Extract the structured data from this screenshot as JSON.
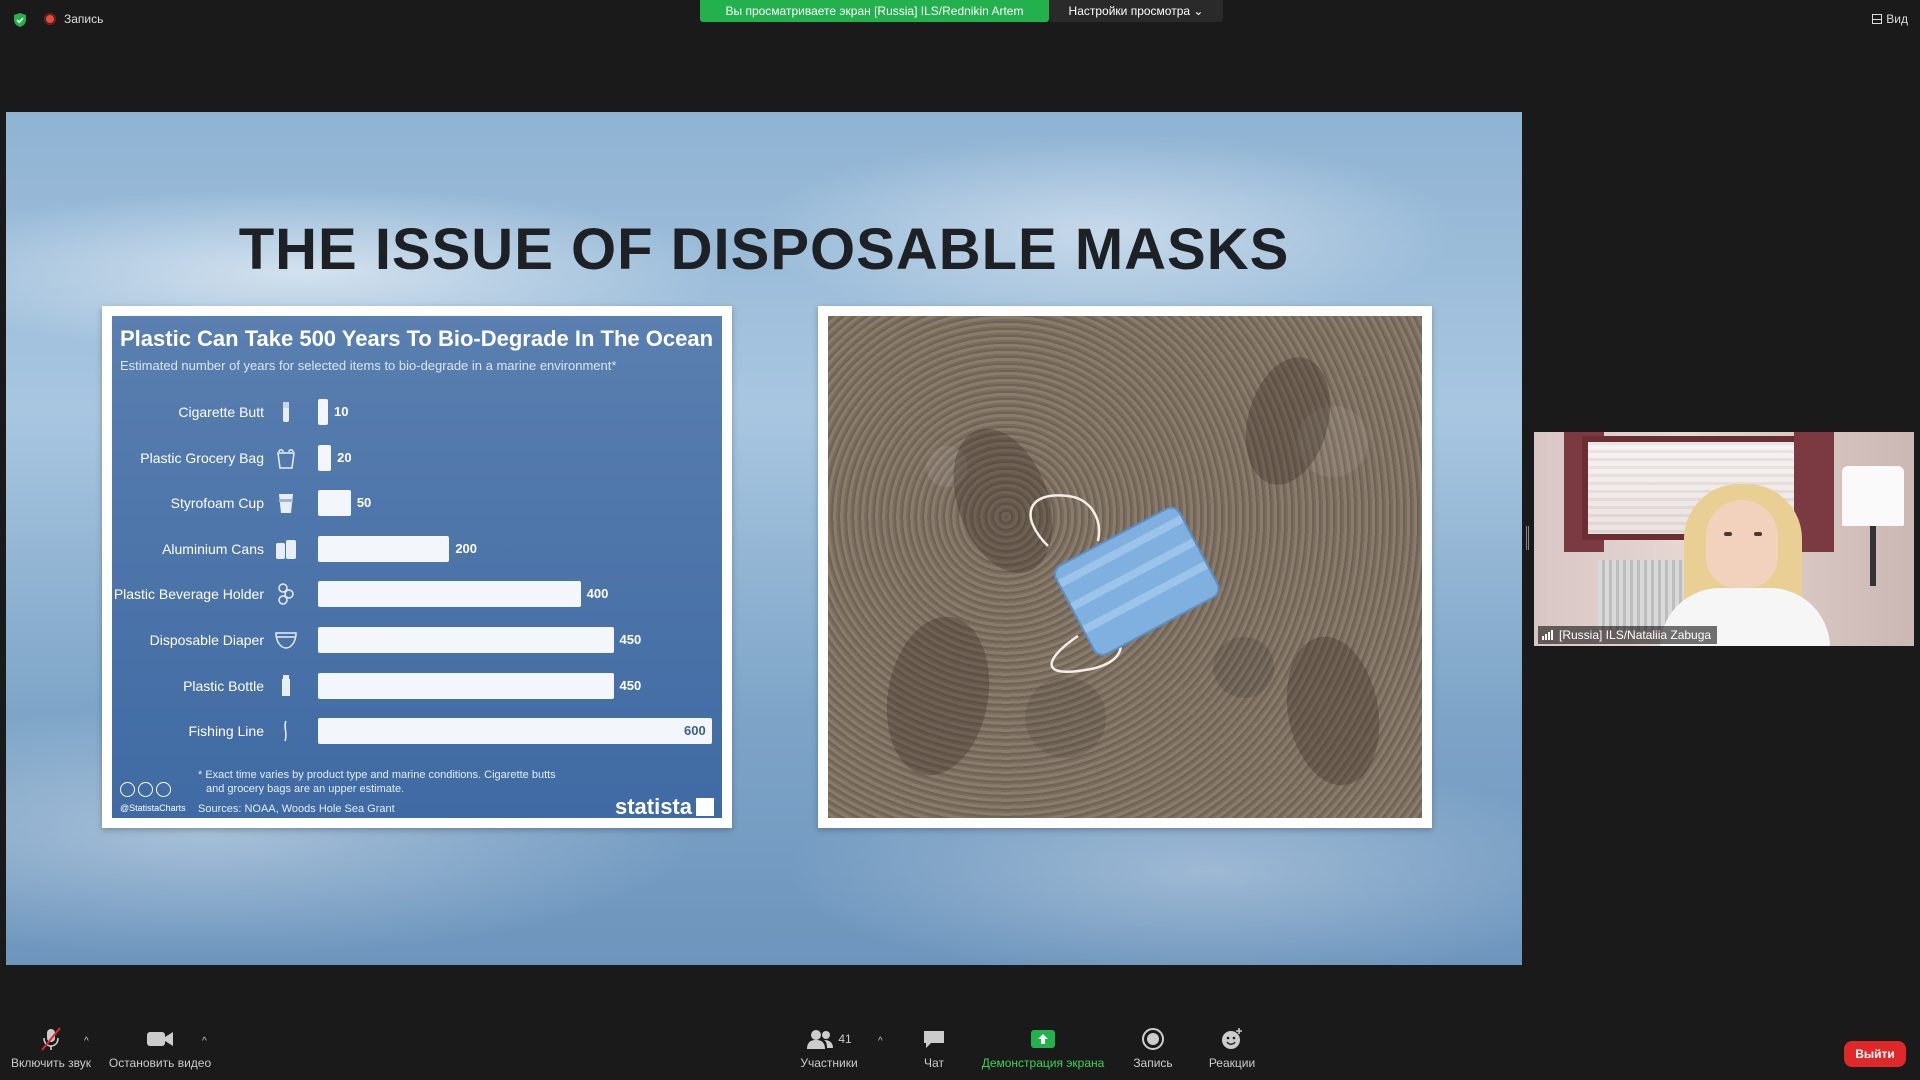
{
  "topbar": {
    "recording_label": "Запись",
    "share_banner": "Вы просматриваете экран [Russia] ILS/Rednikin Artem",
    "view_settings": "Настройки просмотра",
    "view_label": "Вид"
  },
  "slide": {
    "title": "THE ISSUE OF DISPOSABLE MASKS"
  },
  "chart_data": {
    "type": "bar",
    "title": "Plastic Can Take 500 Years To Bio-Degrade In The Ocean",
    "subtitle": "Estimated number of years for selected items to bio-degrade in a marine environment*",
    "categories": [
      "Cigarette Butt",
      "Plastic Grocery Bag",
      "Styrofoam Cup",
      "Aluminium Cans",
      "Plastic Beverage Holder",
      "Disposable Diaper",
      "Plastic Bottle",
      "Fishing Line"
    ],
    "values": [
      10,
      20,
      50,
      200,
      400,
      450,
      450,
      600
    ],
    "xlim": [
      0,
      600
    ],
    "orientation": "horizontal",
    "footnote_line1": "* Exact time varies by product type and marine conditions. Cigarette butts",
    "footnote_line2": "and grocery bags are an upper estimate.",
    "source": "Sources: NOAA, Woods Hole Sea Grant",
    "handle": "@StatistaCharts",
    "brand": "statista",
    "bar_color": "#f3f6fb",
    "background_color": "#4a72a8"
  },
  "participant": {
    "name": "[Russia] ILS/Nataliia Zabuga"
  },
  "toolbar": {
    "unmute_label": "Включить звук",
    "stop_video_label": "Остановить видео",
    "participants_label": "Участники",
    "participants_count": "41",
    "chat_label": "Чат",
    "share_label": "Демонстрация экрана",
    "record_label": "Запись",
    "reactions_label": "Реакции",
    "leave_label": "Выйти"
  },
  "colors": {
    "share_green": "#23b14d",
    "leave_red": "#e02828"
  }
}
